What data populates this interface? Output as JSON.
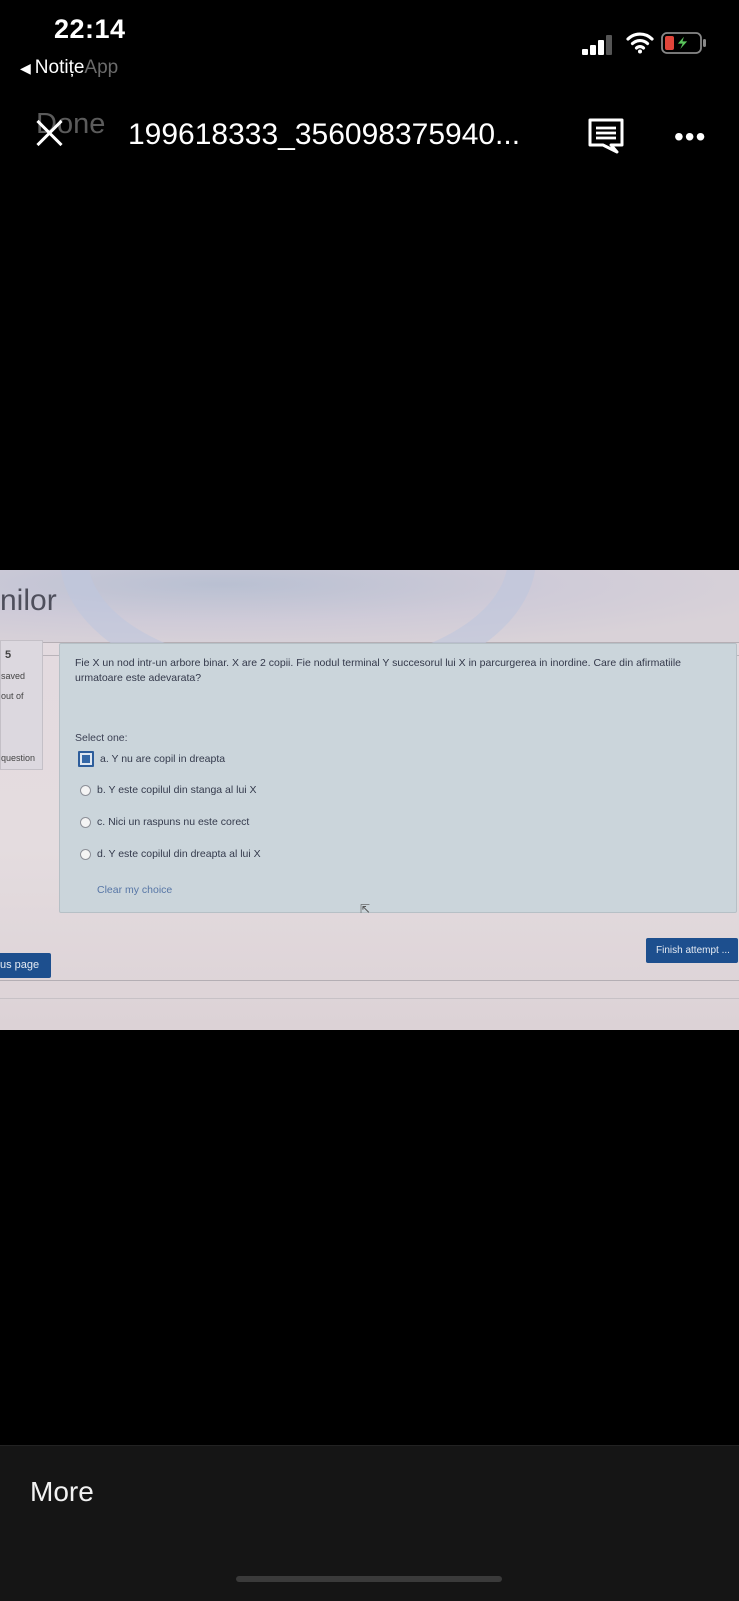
{
  "status_bar": {
    "time": "22:14",
    "back_app": "Notițe",
    "back_app_ghost": "App"
  },
  "header": {
    "done_label": "Done",
    "file_title": "199618333_356098375940..."
  },
  "photo": {
    "page_heading": "nilor",
    "question_info": {
      "number": "5",
      "status": "saved",
      "marks": "out of",
      "flag": "question"
    },
    "question_text": "Fie X un nod intr-un arbore binar. X are 2 copii. Fie nodul terminal Y succesorul lui X in parcurgerea in inordine. Care din afirmatiile urmatoare este adevarata?",
    "select_one": "Select one:",
    "options": [
      {
        "label": "a. Y nu are copil in dreapta",
        "selected": true
      },
      {
        "label": "b. Y este copilul din stanga al lui X",
        "selected": false
      },
      {
        "label": "c. Nici un raspuns nu este corect",
        "selected": false
      },
      {
        "label": "d. Y este copilul din dreapta al lui X",
        "selected": false
      }
    ],
    "clear_choice": "Clear my choice",
    "finish_button": "Finish attempt ...",
    "prev_button": "us page"
  },
  "bottom_bar": {
    "more_label": "More"
  },
  "colors": {
    "question_bg": "#cbd5db",
    "button_blue": "#1d4f8e",
    "link_blue": "#5776a6",
    "battery_red": "#e0453a",
    "battery_green": "#5bc65c"
  },
  "icons": [
    "signal-icon",
    "wifi-icon",
    "battery-charging-icon",
    "close-icon",
    "comment-icon",
    "more-icon",
    "radio-icon",
    "mouse-cursor-icon"
  ]
}
